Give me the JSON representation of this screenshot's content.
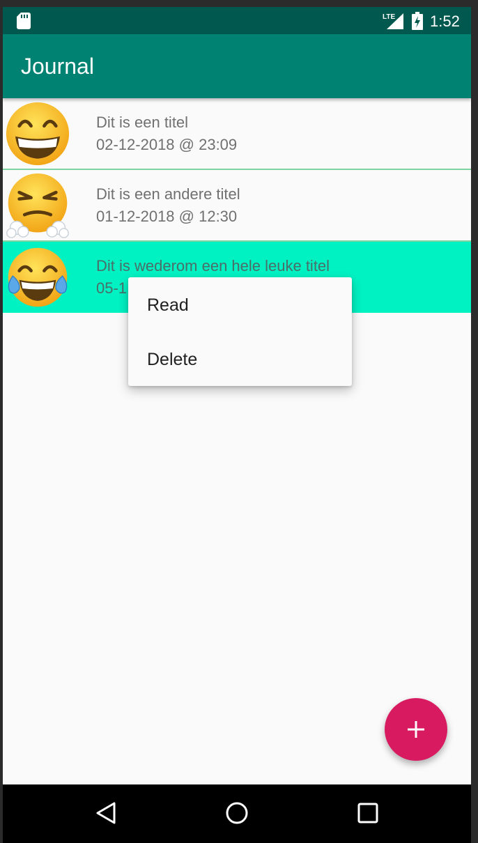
{
  "status_bar": {
    "network_label": "LTE",
    "time": "1:52",
    "icons": [
      "sd-card-icon",
      "lte-signal-icon",
      "battery-charging-icon"
    ]
  },
  "app_bar": {
    "title": "Journal",
    "color": "#008273"
  },
  "entries": [
    {
      "title": "Dit is een titel",
      "date": "02-12-2018 @ 23:09",
      "emoji": "grinning-face-icon"
    },
    {
      "title": "Dit is een andere titel",
      "date": "01-12-2018 @ 12:30",
      "emoji": "angry-steam-face-icon"
    },
    {
      "title": "Dit is wederom een hele leuke titel",
      "date": "05-1",
      "emoji": "tears-of-joy-face-icon",
      "selected": true
    }
  ],
  "context_menu": {
    "items": [
      {
        "label": "Read"
      },
      {
        "label": "Delete"
      }
    ]
  },
  "fab": {
    "icon": "plus-icon",
    "color": "#d81b60"
  },
  "nav_bar": {
    "icons": [
      "back-triangle-icon",
      "home-circle-icon",
      "recents-square-icon"
    ]
  },
  "colors": {
    "status_bar": "#00584e",
    "selected_row": "#00f2c3",
    "separator": "#7fd3a0"
  }
}
